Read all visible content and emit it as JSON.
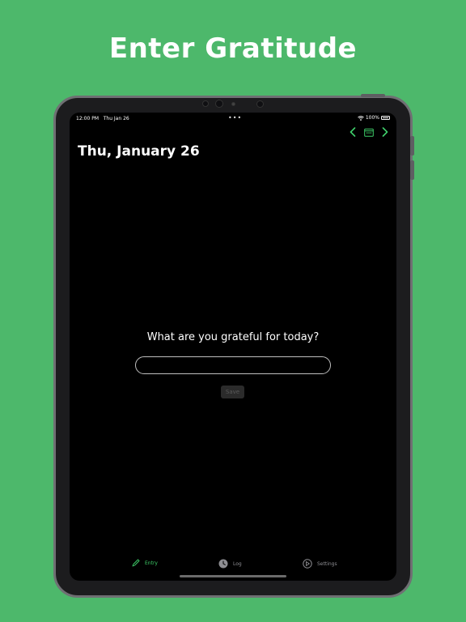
{
  "headline": "Enter Gratitude",
  "status_bar": {
    "time": "12:00 PM",
    "date": "Thu Jan 26",
    "dots": "•••",
    "battery": "100%"
  },
  "nav": {
    "icons": [
      "chevron-left-icon",
      "calendar-icon",
      "chevron-right-icon"
    ]
  },
  "page_title": "Thu, January 26",
  "entry": {
    "prompt": "What are you grateful for today?",
    "input_value": "",
    "input_placeholder": "",
    "save_label": "Save"
  },
  "tabs": [
    {
      "label": "Entry",
      "icon": "pencil-icon",
      "active": true
    },
    {
      "label": "Log",
      "icon": "clock-icon",
      "active": false
    },
    {
      "label": "Settings",
      "icon": "settings-icon",
      "active": false
    }
  ],
  "colors": {
    "background": "#4db86b",
    "accent": "#3fcf6a",
    "screen": "#000000",
    "inactive_tab": "#8e8e93"
  }
}
